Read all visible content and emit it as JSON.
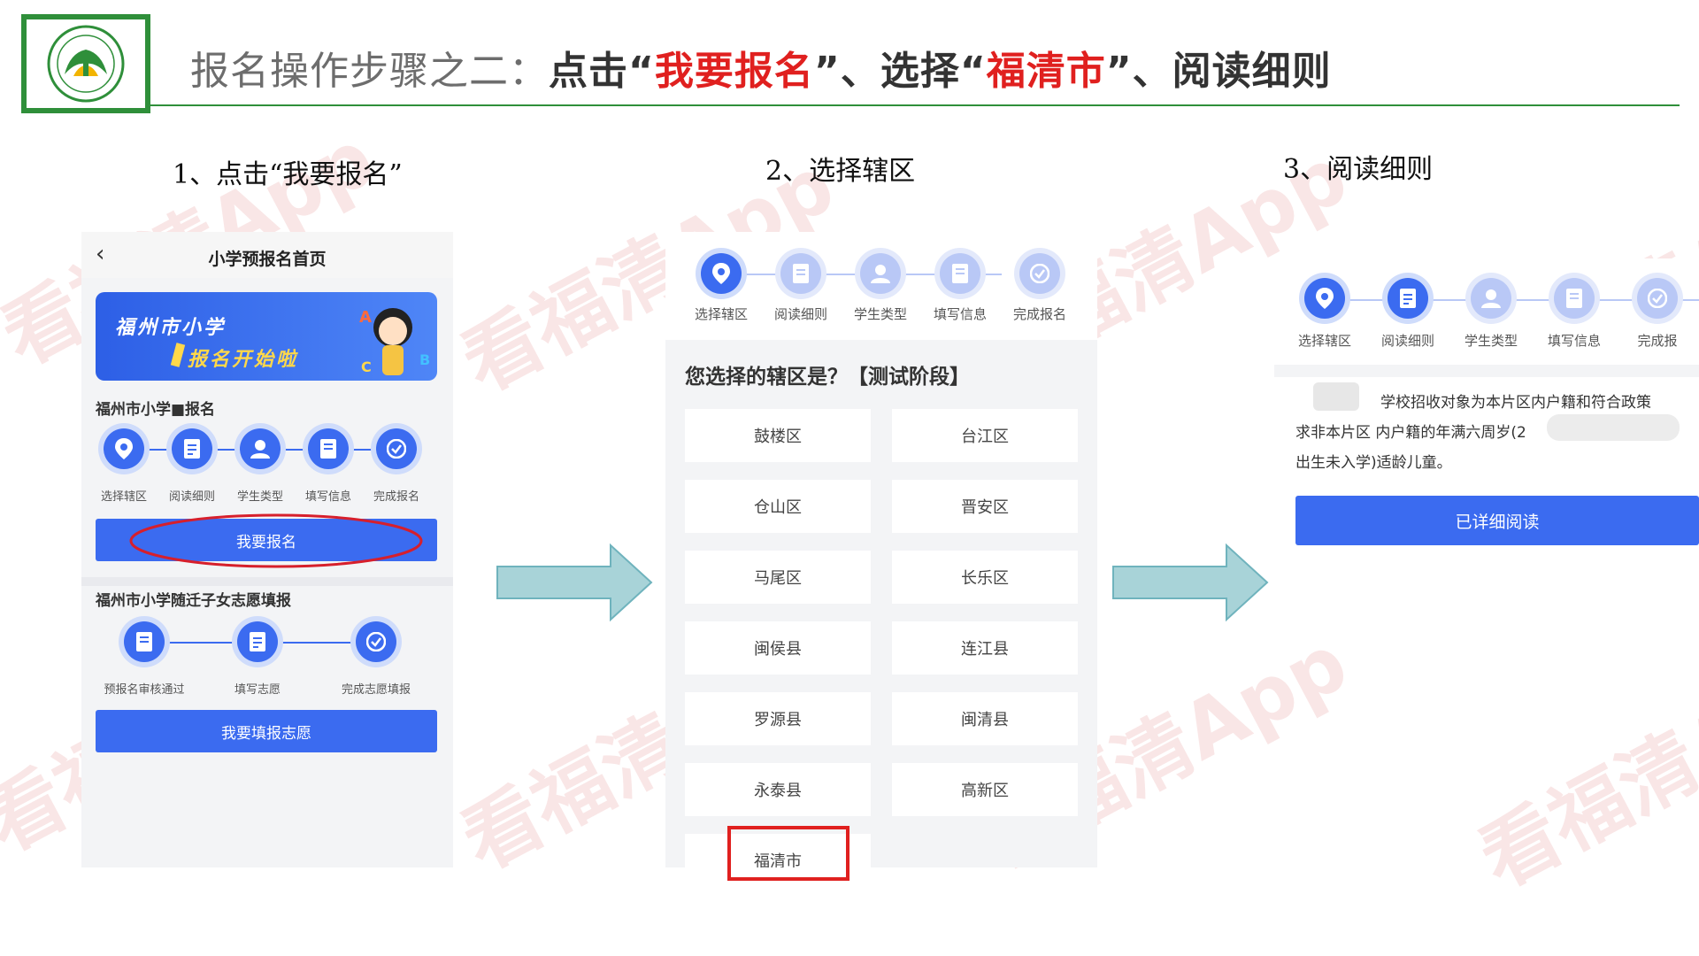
{
  "header": {
    "title_part1": "报名操作步骤之二：",
    "title_part2": "点击“",
    "title_part3": "我要报名",
    "title_part4": "”、选择“",
    "title_part5": "福清市",
    "title_part6": "”、阅读细则"
  },
  "columns": {
    "col1_title": "1、点击“我要报名”",
    "col2_title": "2、选择辖区",
    "col3_title": "3、阅读细则"
  },
  "phone1": {
    "nav_title": "小学预报名首页",
    "banner_line1": "福州市小学",
    "banner_line2": "报名开始啦",
    "section1_title": "福州市小学■报名",
    "steps": [
      "选择辖区",
      "阅读细则",
      "学生类型",
      "填写信息",
      "完成报名"
    ],
    "register_button": "我要报名",
    "section2_title": "福州市小学随迁子女志愿填报",
    "steps2": [
      "预报名审核通过",
      "填写志愿",
      "完成志愿填报"
    ],
    "volunteer_button": "我要填报志愿"
  },
  "phone2": {
    "steps": [
      "选择辖区",
      "阅读细则",
      "学生类型",
      "填写信息",
      "完成报名"
    ],
    "question": "您选择的辖区是？【测试阶段】",
    "districts": [
      "鼓楼区",
      "台江区",
      "仓山区",
      "晋安区",
      "马尾区",
      "长乐区",
      "闽侯县",
      "连江县",
      "罗源县",
      "闽清县",
      "永泰县",
      "高新区",
      "福清市"
    ]
  },
  "phone3": {
    "steps": [
      "选择辖区",
      "阅读细则",
      "学生类型",
      "填写信息",
      "完成报"
    ],
    "rules_line1": "学校招收对象为本片区内户籍和符合政策",
    "rules_line2": "求非本片区 内户籍的年满六周岁(2",
    "rules_line3": "出生未入学)适龄儿童。",
    "confirm_button": "已详细阅读"
  },
  "watermark_text": "看福清App",
  "colors": {
    "accent_blue": "#3b6bf0",
    "header_red": "#e0201f",
    "logo_green": "#2f8f3a",
    "arrow_fill": "#a8d3d8"
  }
}
